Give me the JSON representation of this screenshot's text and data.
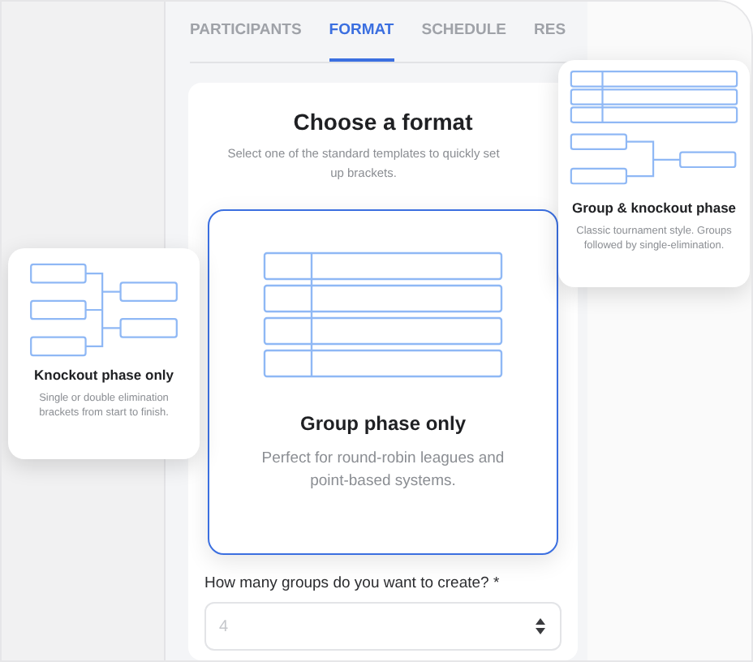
{
  "tabs": [
    {
      "label": "PARTICIPANTS",
      "selected": false
    },
    {
      "label": "FORMAT",
      "selected": true
    },
    {
      "label": "SCHEDULE",
      "selected": false
    },
    {
      "label": "RES",
      "selected": false
    }
  ],
  "format_panel": {
    "title": "Choose a format",
    "description": "Select one of the standard templates to quickly set up brackets."
  },
  "templates": [
    {
      "kind": "group",
      "title": "Group phase only",
      "description": "Perfect for round-robin leagues and point-based systems.",
      "selected": true
    },
    {
      "kind": "knockout",
      "title": "Knockout phase only",
      "description": "Single or double elimination brackets from start to finish.",
      "selected": false
    },
    {
      "kind": "group_knockout",
      "title": "Group & knockout phase",
      "description": "Classic tournament style. Groups followed by single-elimination.",
      "selected": false
    }
  ],
  "groups_field": {
    "label": "How many groups do you want to create? *",
    "placeholder": "4"
  }
}
